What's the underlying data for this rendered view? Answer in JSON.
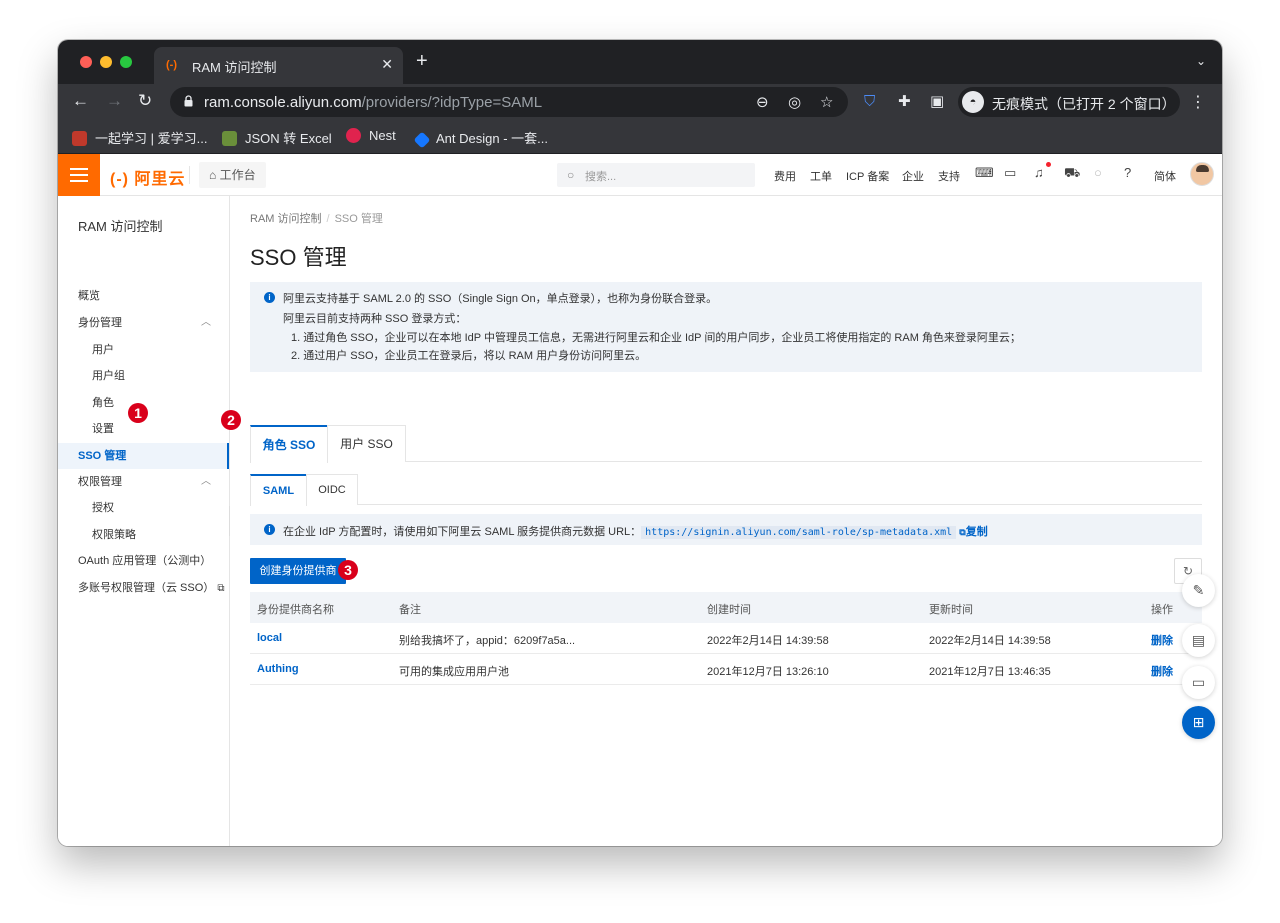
{
  "browser": {
    "tab_title": "RAM 访问控制",
    "tab_favicon": "(-)",
    "url_host": "ram.console.aliyun.com",
    "url_path": "/providers/?idpType=SAML",
    "incognito_label": "无痕模式（已打开 2 个窗口）",
    "bookmarks": [
      "一起学习 | 爱学习...",
      "JSON 转 Excel",
      "Nest",
      "Ant Design - 一套..."
    ]
  },
  "header": {
    "logo": "(-) 阿里云",
    "workbench": "工作台",
    "search_placeholder": "搜索...",
    "nav": [
      "费用",
      "工单",
      "ICP 备案",
      "企业",
      "支持"
    ],
    "lang": "简体"
  },
  "sidebar": {
    "title": "RAM 访问控制",
    "overview": "概览",
    "identity": "身份管理",
    "users": "用户",
    "groups": "用户组",
    "roles": "角色",
    "settings": "设置",
    "sso": "SSO 管理",
    "permission": "权限管理",
    "grant": "授权",
    "policies": "权限策略",
    "oauth": "OAuth 应用管理（公测中）",
    "multi_account": "多账号权限管理（云 SSO）"
  },
  "annotations": [
    "1",
    "2",
    "3"
  ],
  "main": {
    "breadcrumb": [
      "RAM 访问控制",
      "SSO 管理"
    ],
    "title": "SSO 管理",
    "info": {
      "line1": "阿里云支持基于 SAML 2.0 的 SSO（Single Sign On，单点登录），也称为身份联合登录。",
      "line2": "阿里云目前支持两种 SSO 登录方式：",
      "line3": "1. 通过角色 SSO，企业可以在本地 IdP 中管理员工信息，无需进行阿里云和企业 IdP 间的用户同步，企业员工将使用指定的 RAM 角色来登录阿里云；",
      "line4": "2. 通过用户 SSO，企业员工在登录后，将以 RAM 用户身份访问阿里云。"
    },
    "tabs": [
      "角色 SSO",
      "用户 SSO"
    ],
    "subtabs": [
      "SAML",
      "OIDC"
    ],
    "url_info": {
      "prefix": "在企业 IdP 方配置时，请使用如下阿里云 SAML 服务提供商元数据 URL：",
      "url": "https://signin.aliyun.com/saml-role/sp-metadata.xml",
      "copy": "复制"
    },
    "create_button": "创建身份提供商",
    "table": {
      "headers": [
        "身份提供商名称",
        "备注",
        "创建时间",
        "更新时间",
        "操作"
      ],
      "rows": [
        {
          "name": "local",
          "note": "别给我搞坏了，appid：6209f7a5a...",
          "created": "2022年2月14日 14:39:58",
          "updated": "2022年2月14日 14:39:58",
          "action": "删除"
        },
        {
          "name": "Authing",
          "note": "可用的集成应用用户池",
          "created": "2021年12月7日 13:26:10",
          "updated": "2021年12月7日 13:46:35",
          "action": "删除"
        }
      ]
    }
  },
  "colors": {
    "brand": "#ff6a00",
    "primary": "#0064c8",
    "badge": "#d9001b"
  }
}
